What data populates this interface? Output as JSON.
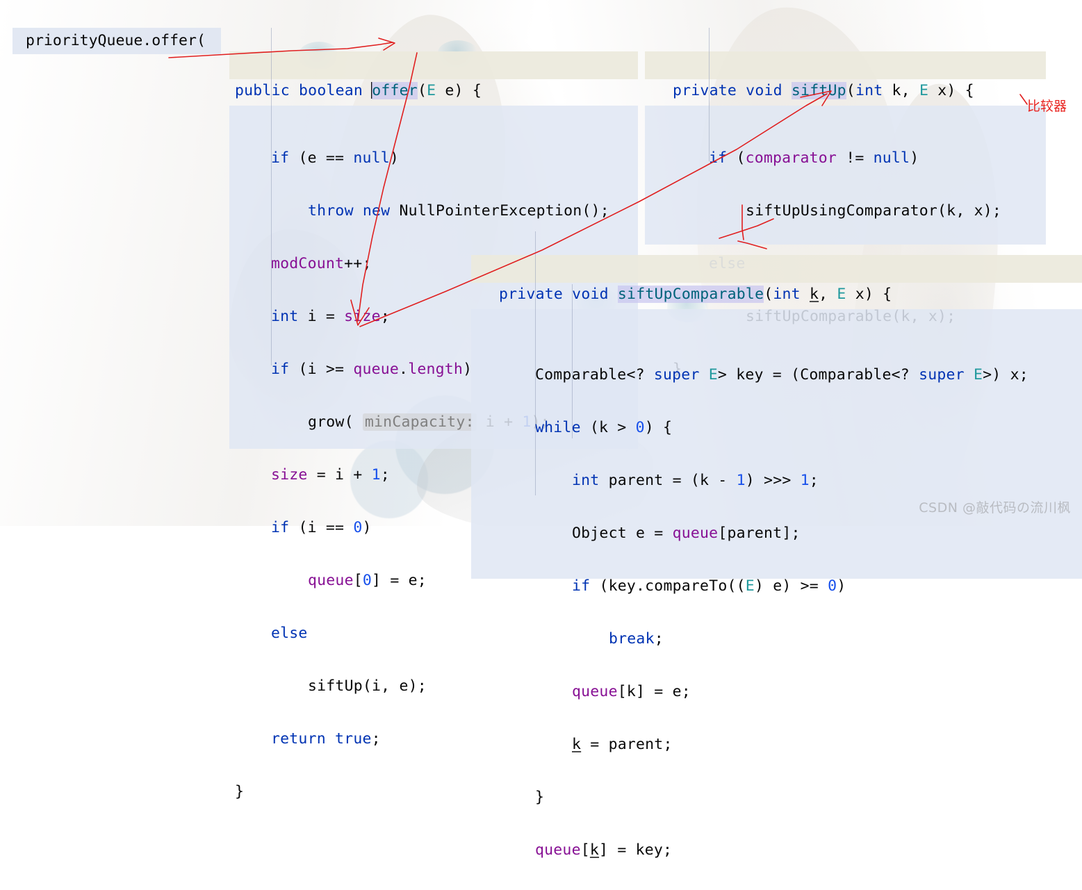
{
  "colors": {
    "keyword": "#0033b3",
    "type": "#20999d",
    "field": "#871094",
    "method": "#00627a",
    "number": "#1750eb",
    "plain": "#080808",
    "signature_bg": "#eceadd",
    "body_bg": "#e0e6f3",
    "name_highlight": "#c7c4ef",
    "annotation_red": "#e8231f",
    "watermark_gray": "#b9bcc2"
  },
  "call_site": {
    "text": "priorityQueue.offer("
  },
  "panels": {
    "offer": {
      "signature": "public boolean offer(E e) {",
      "lines": [
        "if (e == null)",
        "throw new NullPointerException();",
        "modCount++;",
        "int i = size;",
        "if (i >= queue.length)",
        "grow( minCapacity: i + 1);",
        "size = i + 1;",
        "if (i == 0)",
        "queue[0] = e;",
        "else",
        "siftUp(i, e);",
        "return true;",
        "}"
      ],
      "parameter_hint": "minCapacity:"
    },
    "siftUp": {
      "signature": "private void siftUp(int k, E x) {",
      "lines": [
        "if (comparator != null)",
        "siftUpUsingComparator(k, x);",
        "else",
        "siftUpComparable(k, x);",
        "}"
      ]
    },
    "siftUpComparable": {
      "signature": "private void siftUpComparable(int k, E x) {",
      "lines": [
        "Comparable<? super E> key = (Comparable<? super E>) x;",
        "while (k > 0) {",
        "int parent = (k - 1) >>> 1;",
        "Object e = queue[parent];",
        "if (key.compareTo((E) e) >= 0)",
        "break;",
        "queue[k] = e;",
        "k = parent;",
        "}",
        "queue[k] = key;"
      ]
    }
  },
  "annotations": {
    "comparator_note": "比较器"
  },
  "watermark": {
    "text": "CSDN @敲代码の流川枫"
  }
}
